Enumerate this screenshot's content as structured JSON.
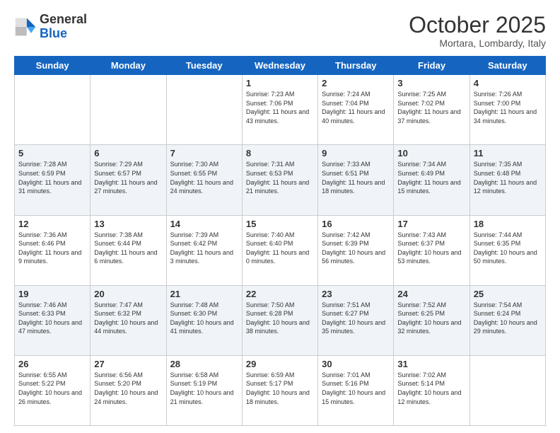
{
  "header": {
    "logo_general": "General",
    "logo_blue": "Blue",
    "month_title": "October 2025",
    "location": "Mortara, Lombardy, Italy"
  },
  "days_of_week": [
    "Sunday",
    "Monday",
    "Tuesday",
    "Wednesday",
    "Thursday",
    "Friday",
    "Saturday"
  ],
  "weeks": [
    [
      {
        "day": null
      },
      {
        "day": null
      },
      {
        "day": null
      },
      {
        "day": "1",
        "sunrise": "Sunrise: 7:23 AM",
        "sunset": "Sunset: 7:06 PM",
        "daylight": "Daylight: 11 hours and 43 minutes."
      },
      {
        "day": "2",
        "sunrise": "Sunrise: 7:24 AM",
        "sunset": "Sunset: 7:04 PM",
        "daylight": "Daylight: 11 hours and 40 minutes."
      },
      {
        "day": "3",
        "sunrise": "Sunrise: 7:25 AM",
        "sunset": "Sunset: 7:02 PM",
        "daylight": "Daylight: 11 hours and 37 minutes."
      },
      {
        "day": "4",
        "sunrise": "Sunrise: 7:26 AM",
        "sunset": "Sunset: 7:00 PM",
        "daylight": "Daylight: 11 hours and 34 minutes."
      }
    ],
    [
      {
        "day": "5",
        "sunrise": "Sunrise: 7:28 AM",
        "sunset": "Sunset: 6:59 PM",
        "daylight": "Daylight: 11 hours and 31 minutes."
      },
      {
        "day": "6",
        "sunrise": "Sunrise: 7:29 AM",
        "sunset": "Sunset: 6:57 PM",
        "daylight": "Daylight: 11 hours and 27 minutes."
      },
      {
        "day": "7",
        "sunrise": "Sunrise: 7:30 AM",
        "sunset": "Sunset: 6:55 PM",
        "daylight": "Daylight: 11 hours and 24 minutes."
      },
      {
        "day": "8",
        "sunrise": "Sunrise: 7:31 AM",
        "sunset": "Sunset: 6:53 PM",
        "daylight": "Daylight: 11 hours and 21 minutes."
      },
      {
        "day": "9",
        "sunrise": "Sunrise: 7:33 AM",
        "sunset": "Sunset: 6:51 PM",
        "daylight": "Daylight: 11 hours and 18 minutes."
      },
      {
        "day": "10",
        "sunrise": "Sunrise: 7:34 AM",
        "sunset": "Sunset: 6:49 PM",
        "daylight": "Daylight: 11 hours and 15 minutes."
      },
      {
        "day": "11",
        "sunrise": "Sunrise: 7:35 AM",
        "sunset": "Sunset: 6:48 PM",
        "daylight": "Daylight: 11 hours and 12 minutes."
      }
    ],
    [
      {
        "day": "12",
        "sunrise": "Sunrise: 7:36 AM",
        "sunset": "Sunset: 6:46 PM",
        "daylight": "Daylight: 11 hours and 9 minutes."
      },
      {
        "day": "13",
        "sunrise": "Sunrise: 7:38 AM",
        "sunset": "Sunset: 6:44 PM",
        "daylight": "Daylight: 11 hours and 6 minutes."
      },
      {
        "day": "14",
        "sunrise": "Sunrise: 7:39 AM",
        "sunset": "Sunset: 6:42 PM",
        "daylight": "Daylight: 11 hours and 3 minutes."
      },
      {
        "day": "15",
        "sunrise": "Sunrise: 7:40 AM",
        "sunset": "Sunset: 6:40 PM",
        "daylight": "Daylight: 11 hours and 0 minutes."
      },
      {
        "day": "16",
        "sunrise": "Sunrise: 7:42 AM",
        "sunset": "Sunset: 6:39 PM",
        "daylight": "Daylight: 10 hours and 56 minutes."
      },
      {
        "day": "17",
        "sunrise": "Sunrise: 7:43 AM",
        "sunset": "Sunset: 6:37 PM",
        "daylight": "Daylight: 10 hours and 53 minutes."
      },
      {
        "day": "18",
        "sunrise": "Sunrise: 7:44 AM",
        "sunset": "Sunset: 6:35 PM",
        "daylight": "Daylight: 10 hours and 50 minutes."
      }
    ],
    [
      {
        "day": "19",
        "sunrise": "Sunrise: 7:46 AM",
        "sunset": "Sunset: 6:33 PM",
        "daylight": "Daylight: 10 hours and 47 minutes."
      },
      {
        "day": "20",
        "sunrise": "Sunrise: 7:47 AM",
        "sunset": "Sunset: 6:32 PM",
        "daylight": "Daylight: 10 hours and 44 minutes."
      },
      {
        "day": "21",
        "sunrise": "Sunrise: 7:48 AM",
        "sunset": "Sunset: 6:30 PM",
        "daylight": "Daylight: 10 hours and 41 minutes."
      },
      {
        "day": "22",
        "sunrise": "Sunrise: 7:50 AM",
        "sunset": "Sunset: 6:28 PM",
        "daylight": "Daylight: 10 hours and 38 minutes."
      },
      {
        "day": "23",
        "sunrise": "Sunrise: 7:51 AM",
        "sunset": "Sunset: 6:27 PM",
        "daylight": "Daylight: 10 hours and 35 minutes."
      },
      {
        "day": "24",
        "sunrise": "Sunrise: 7:52 AM",
        "sunset": "Sunset: 6:25 PM",
        "daylight": "Daylight: 10 hours and 32 minutes."
      },
      {
        "day": "25",
        "sunrise": "Sunrise: 7:54 AM",
        "sunset": "Sunset: 6:24 PM",
        "daylight": "Daylight: 10 hours and 29 minutes."
      }
    ],
    [
      {
        "day": "26",
        "sunrise": "Sunrise: 6:55 AM",
        "sunset": "Sunset: 5:22 PM",
        "daylight": "Daylight: 10 hours and 26 minutes."
      },
      {
        "day": "27",
        "sunrise": "Sunrise: 6:56 AM",
        "sunset": "Sunset: 5:20 PM",
        "daylight": "Daylight: 10 hours and 24 minutes."
      },
      {
        "day": "28",
        "sunrise": "Sunrise: 6:58 AM",
        "sunset": "Sunset: 5:19 PM",
        "daylight": "Daylight: 10 hours and 21 minutes."
      },
      {
        "day": "29",
        "sunrise": "Sunrise: 6:59 AM",
        "sunset": "Sunset: 5:17 PM",
        "daylight": "Daylight: 10 hours and 18 minutes."
      },
      {
        "day": "30",
        "sunrise": "Sunrise: 7:01 AM",
        "sunset": "Sunset: 5:16 PM",
        "daylight": "Daylight: 10 hours and 15 minutes."
      },
      {
        "day": "31",
        "sunrise": "Sunrise: 7:02 AM",
        "sunset": "Sunset: 5:14 PM",
        "daylight": "Daylight: 10 hours and 12 minutes."
      },
      {
        "day": null
      }
    ]
  ]
}
